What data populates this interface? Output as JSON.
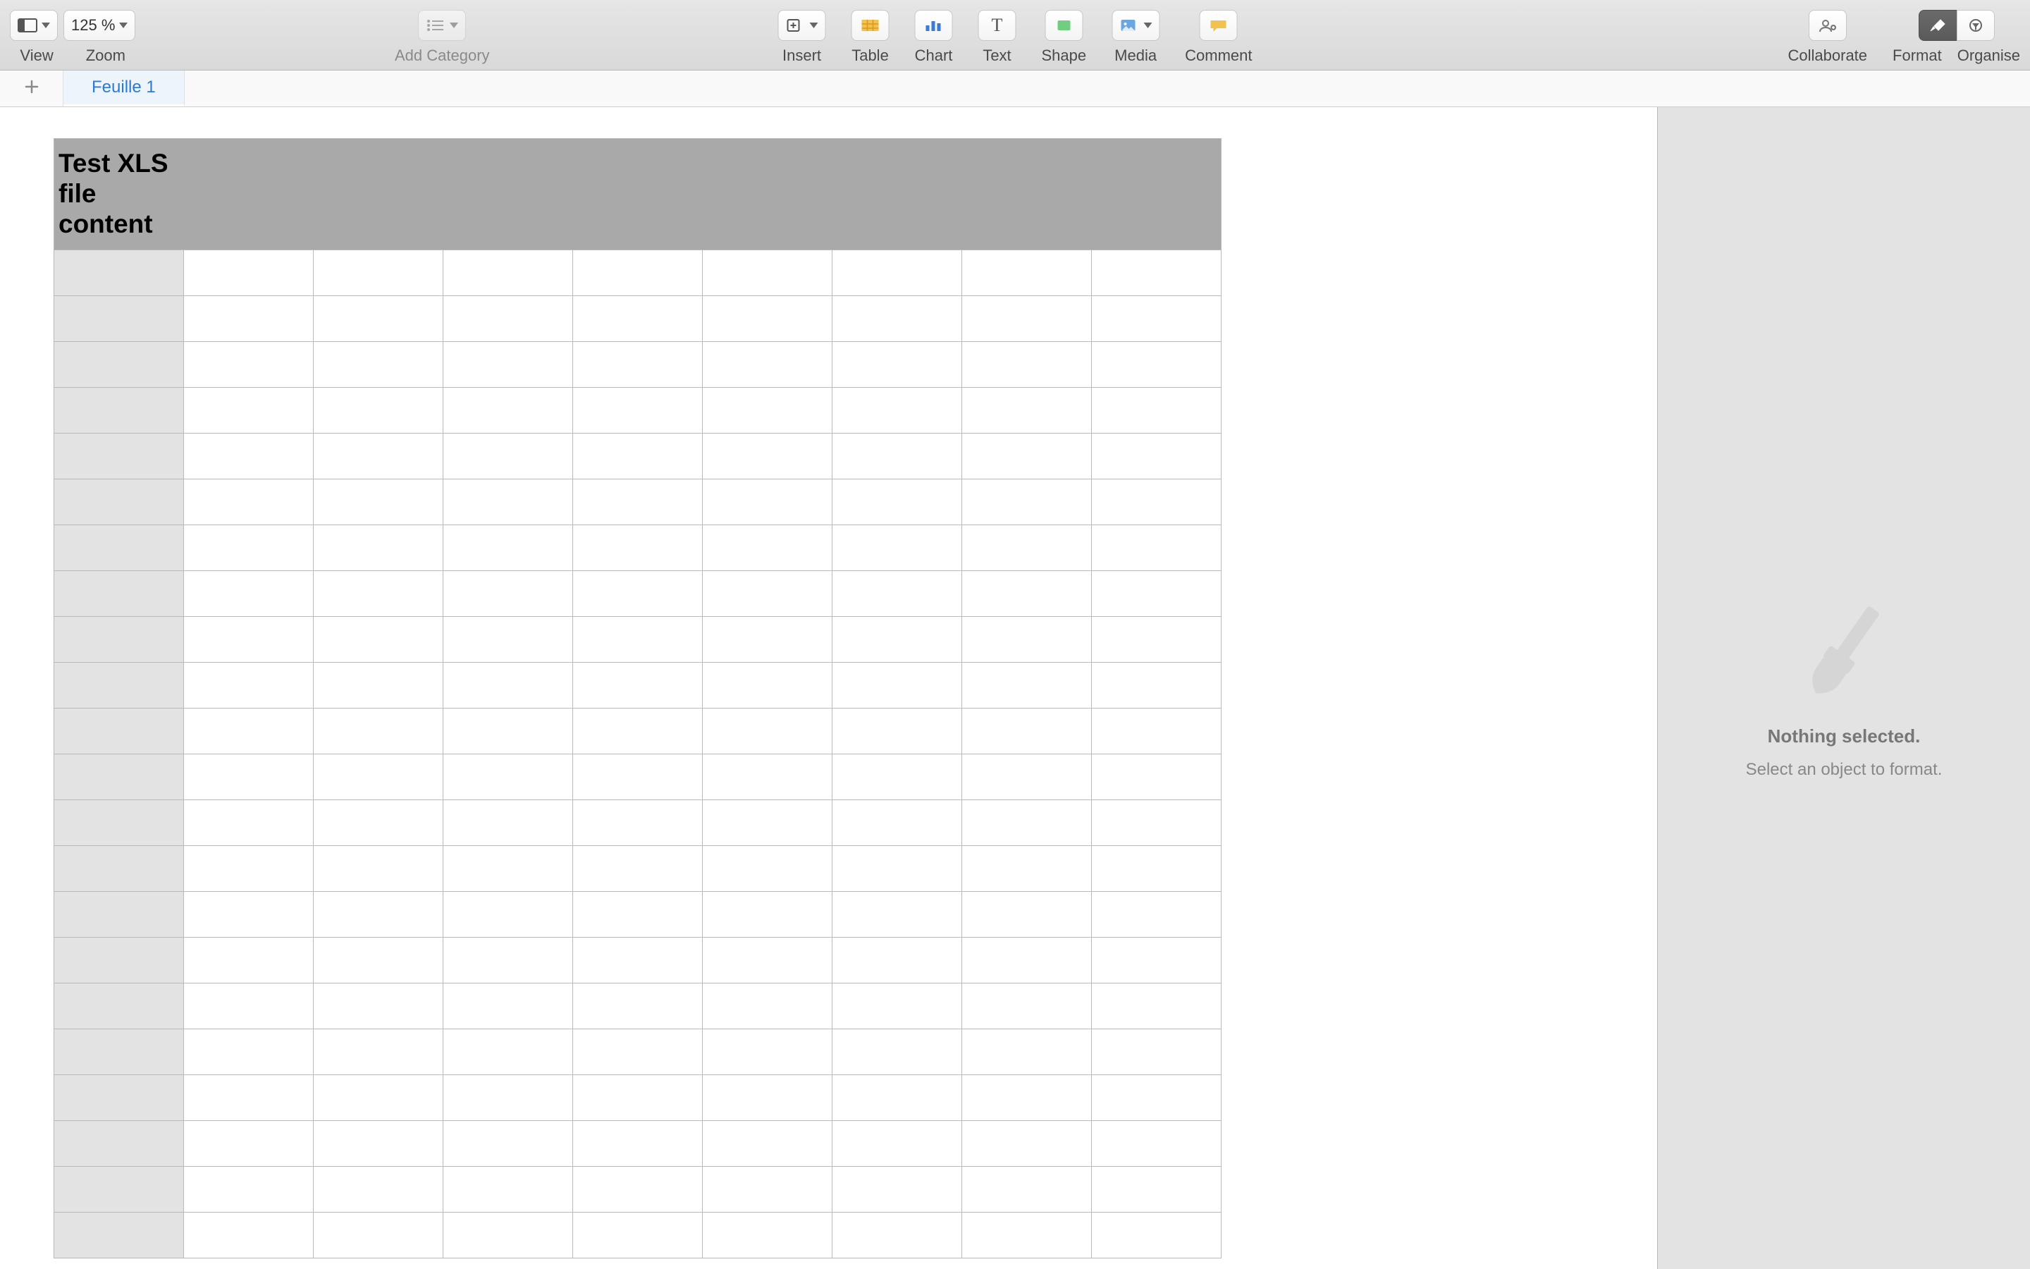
{
  "toolbar": {
    "view_label": "View",
    "zoom_label": "Zoom",
    "zoom_value": "125 %",
    "add_category_label": "Add Category",
    "insert_label": "Insert",
    "table_label": "Table",
    "chart_label": "Chart",
    "text_label": "Text",
    "shape_label": "Shape",
    "media_label": "Media",
    "comment_label": "Comment",
    "collaborate_label": "Collaborate",
    "format_label": "Format",
    "organise_label": "Organise"
  },
  "tabs": {
    "sheet1": "Feuille 1"
  },
  "table": {
    "title": "Test XLS\nfile\ncontent",
    "body_rows": 22,
    "body_cols": 8
  },
  "inspector": {
    "title": "Nothing selected.",
    "subtitle": "Select an object to format."
  }
}
